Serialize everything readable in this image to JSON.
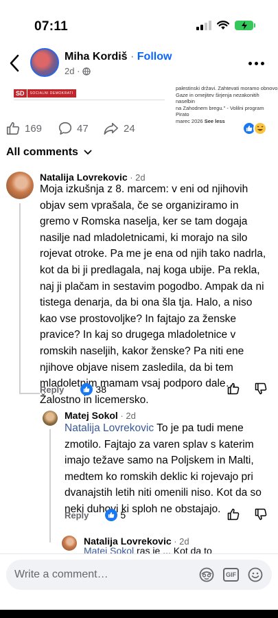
{
  "status": {
    "time": "07:11"
  },
  "header": {
    "author": "Miha Kordiš",
    "separator": " · ",
    "follow": "Follow",
    "age": "2d ·"
  },
  "post_strip": {
    "logo_initials": "SD",
    "logo_text": "SOCIALNI DEMOKRATI",
    "text_lines": [
      "palestinski državi. Zahtevati moramo obnovo",
      "Gaze in omejitev širjenja nezakonitih naselbin",
      "na Zahodnem bregu.\" - Volilni program Pirato",
      "marec 2026"
    ],
    "see_less": "See less"
  },
  "reactions": {
    "likes": "169",
    "comments": "47",
    "shares": "24"
  },
  "all_comments": "All comments",
  "comments": [
    {
      "name": "Natalija Lovrekovic",
      "time": " · 2d",
      "lines": [
        "Moja izkušnja z 8. marcem: v eni od njihovih",
        "objav sem vprašala, če se organiziramo in",
        "gremo v Romska naselja, ker se tam dogaja",
        "nasilje nad mladoletnicami, ki morajo na silo",
        "rojevat otroke. Pa me je ena od njih tako nadrla,",
        "kot da bi ji predlagala, naj koga ubije. Pa rekla,",
        "naj ji plačam in sestavim pogodbo. Ampak da ni",
        "tistega denarja, da bi ona šla tja. Halo, a niso",
        "kao vse prostovoljke? In fajtajo za ženske",
        "pravice? In kaj so drugega mladoletnice v",
        "romskih naseljih, kakor ženske? Pa niti ene",
        "njihove objave nisem zasledila, da bi tem",
        "mladoletnim mamam vsaj podporo dale…",
        "Žalostno in licemersko."
      ],
      "reply": "Reply",
      "likes": "38"
    },
    {
      "name": "Matej Sokol",
      "time": " · 2d",
      "mention": "Natalija Lovrekovic",
      "lines": [
        " To je pa tudi mene",
        "zmotilo. Fajtajo za varen splav s katerim",
        "imajo težave samo na Poljskem in Malti,",
        "medtem ko romskih deklic ki rojevajo pri",
        "dvanajstih letih niti omenili niso. Kot da so",
        "neki duhovi ki sploh ne obstajajo."
      ],
      "reply": "Reply",
      "likes": "5"
    },
    {
      "name": "Natalija Lovrekovic",
      "time": " · 2d",
      "partial_mention": "Matej Sokol",
      "partial_text": " ras je ... ",
      "partial_tail": "Kot da to"
    }
  ],
  "composer": {
    "placeholder": "Write a comment…",
    "gif": "GIF"
  }
}
